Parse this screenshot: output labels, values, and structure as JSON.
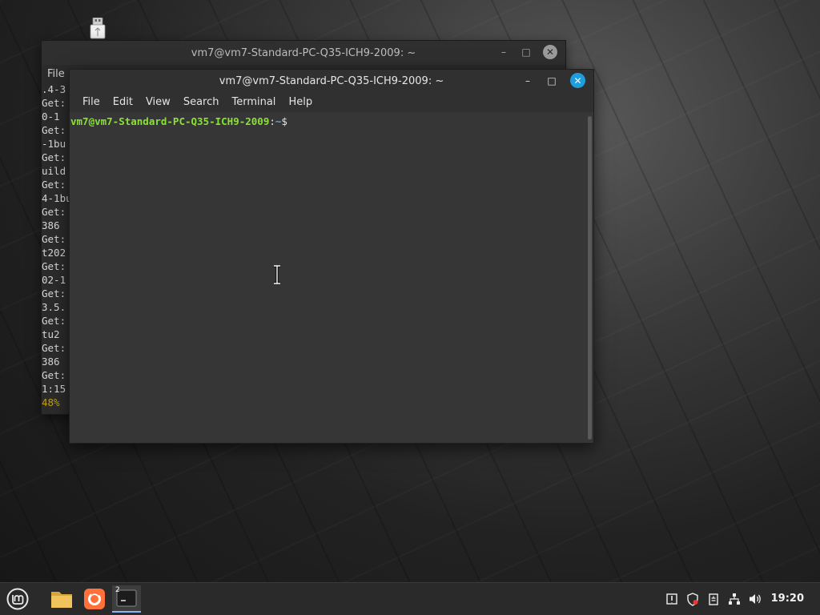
{
  "desktop": {
    "icon_name": "usb-drive-icon"
  },
  "back_window": {
    "title": "vm7@vm7-Standard-PC-Q35-ICH9-2009: ~",
    "menu_first": "File",
    "lines": [
      ".4-3",
      "Get:",
      "0-1",
      "Get:",
      "-1bu",
      "Get:",
      "uild",
      "Get:",
      "4-1bu",
      "Get:",
      "386 ",
      "Get:",
      "t202",
      "Get:",
      "02-1",
      "Get:",
      "3.5.",
      "Get:",
      "tu2",
      "Get:",
      "386 ",
      "Get:",
      "1:15"
    ],
    "progress_text": "48%",
    "min_glyph": "–",
    "max_glyph": "□",
    "close_glyph": "✕"
  },
  "front_window": {
    "title": "vm7@vm7-Standard-PC-Q35-ICH9-2009: ~",
    "menu": [
      "File",
      "Edit",
      "View",
      "Search",
      "Terminal",
      "Help"
    ],
    "prompt_user": "vm7@vm7-Standard-PC-Q35-ICH9-2009",
    "prompt_sep": ":",
    "prompt_path": "~",
    "prompt_symbol": "$",
    "min_glyph": "–",
    "max_glyph": "□",
    "close_glyph": "✕"
  },
  "taskbar": {
    "terminal_badge": "2",
    "clock": "19:20",
    "tray_icons": [
      "update-manager-icon",
      "shield-icon",
      "clipboard-icon",
      "network-icon",
      "volume-icon"
    ]
  },
  "colors": {
    "prompt_user": "#8ae234",
    "prompt_path": "#729fcf",
    "close_active": "#1f9ede",
    "progress": "#c4a000"
  }
}
